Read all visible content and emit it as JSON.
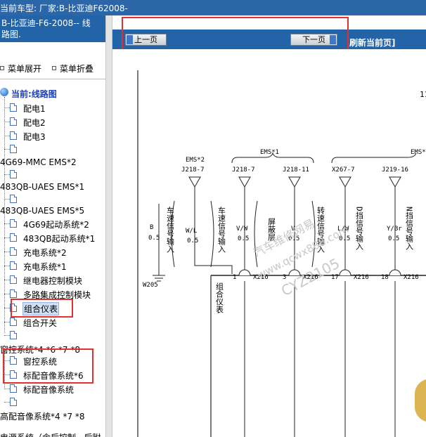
{
  "window": {
    "title_line": "当前车型:   厂家:B-比亚迪F62008-"
  },
  "sidebar": {
    "title_line1": "B-比亚迪-F6-2008-- 线",
    "title_line2": "路图.",
    "expand_label": "菜单展开",
    "collapse_label": "菜单折叠",
    "current_label": "当前:线路图",
    "items": [
      {
        "label": "配电1"
      },
      {
        "label": "配电2"
      },
      {
        "label": "配电3"
      },
      {
        "label": ""
      },
      {
        "label": "4G69-MMC EMS*2"
      },
      {
        "label": ""
      },
      {
        "label": "483QB-UAES EMS*1"
      },
      {
        "label": ""
      },
      {
        "label": "483QB-UAES EMS*5"
      },
      {
        "label": "4G69起动系统*2"
      },
      {
        "label": "483QB起动系统*1"
      },
      {
        "label": "充电系统*2"
      },
      {
        "label": "充电系统*1"
      },
      {
        "label": "继电器控制模块"
      },
      {
        "label": "多路集成控制模块"
      },
      {
        "label": "组合仪表"
      },
      {
        "label": "组合开关"
      },
      {
        "label": ""
      },
      {
        "label": "窗控系统*4 *6 *7 *8"
      },
      {
        "label": "窗控系统"
      },
      {
        "label": "标配音像系统*6"
      },
      {
        "label": "标配音像系统"
      },
      {
        "label": ""
      },
      {
        "label": "高配音像系统*4 *7 *8"
      },
      {
        "label": "电源系统（含后控制···后附···"
      }
    ]
  },
  "content": {
    "prev_button": "上一页",
    "next_button": "下一页",
    "refresh_label": "刷新当前页]"
  },
  "diagram": {
    "page_no": "11",
    "group_ems2": "EMS*2",
    "group_ems1": "EMS*1",
    "group_ems_right": "EMS*",
    "connectors_top": [
      "J218-7",
      "J218-7",
      "J218-11",
      "X267-7",
      "J219-16"
    ],
    "wires": [
      {
        "name": "B",
        "size": "0.5"
      },
      {
        "name": "W/L",
        "size": "0.5"
      },
      {
        "name": "V/W",
        "size": "0.5"
      },
      {
        "name": "V",
        "size": "0.5"
      },
      {
        "name": "L/W",
        "size": "0.5"
      },
      {
        "name": "Y/Br",
        "size": "0.5"
      }
    ],
    "signal_labels": [
      "车速信号输入",
      "车速信号输入",
      "屏蔽层",
      "转速信号输入",
      "D挡信号输入",
      "N挡信号输入"
    ],
    "ground": "W205",
    "pins": [
      {
        "pin": "1",
        "conn": "X216"
      },
      {
        "pin": "3",
        "conn": "X216"
      },
      {
        "pin": "17",
        "conn": "X216"
      },
      {
        "pin": "18",
        "conn": "X216"
      }
    ],
    "component_label": "组合仪表",
    "watermark_line1": "汽车维修网易",
    "watermark_line2": "www.qcwx888.com",
    "watermark_line3": "CYZ2105"
  }
}
